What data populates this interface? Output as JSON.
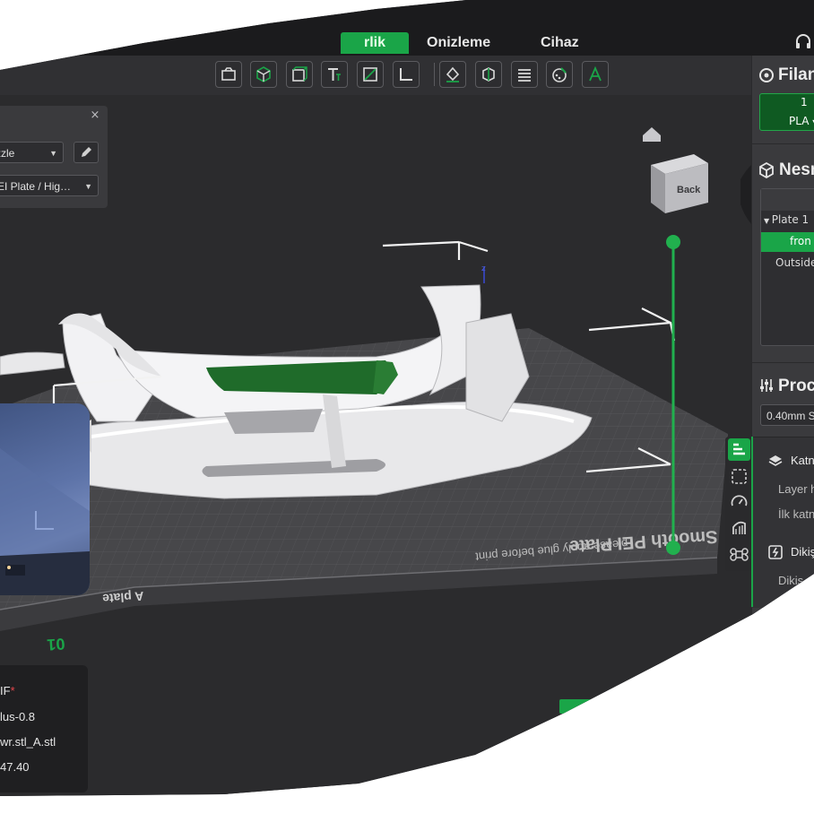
{
  "tabs": {
    "prepare": "rlik",
    "preview": "Onizleme",
    "device": "Cihaz"
  },
  "printer": {
    "nozzle_value": "zzle",
    "plate_value": "EI Plate / Hig…",
    "close": "×"
  },
  "info": {
    "line1": "IF",
    "line1_marker": "*",
    "line2": "lus-0.8",
    "line3": "wr.stl_A.stl",
    "line4": "47.40"
  },
  "sidebar": {
    "filament": {
      "title": "Filan",
      "slot_number": "1",
      "slot_type": "PLA"
    },
    "objects": {
      "title": "Nesn",
      "plate": "Plate 1",
      "selected": "fron",
      "outside": "Outside"
    },
    "process": {
      "title": "Proc",
      "preset": "0.40mm S"
    },
    "params": {
      "group1": "Katn",
      "row1": "Layer h",
      "row2": "İlk katn",
      "group2": "Dikiş",
      "row3": "Dikiş"
    }
  },
  "viewport": {
    "cube_face": "Back",
    "bed_label_1": "Smooth PEI Plate",
    "bed_label_2": "please apply glue before print",
    "plate_label": "A plate",
    "plate_number": "01",
    "axis_z": "z"
  },
  "colors": {
    "accent": "#1aa548",
    "panel": "#3a3a3d",
    "topbar": "#1b1b1d",
    "viewport": "#2b2b2d",
    "selection_green": "#1f6b2a"
  },
  "icons": {
    "toolbar": [
      "box-add-icon",
      "cube-color-icon",
      "cube-outline-icon",
      "text-icon",
      "cut-icon",
      "measure-icon",
      "support-paint-icon",
      "seam-icon",
      "layer-icon",
      "color-paint-icon",
      "text-emboss-icon"
    ]
  }
}
